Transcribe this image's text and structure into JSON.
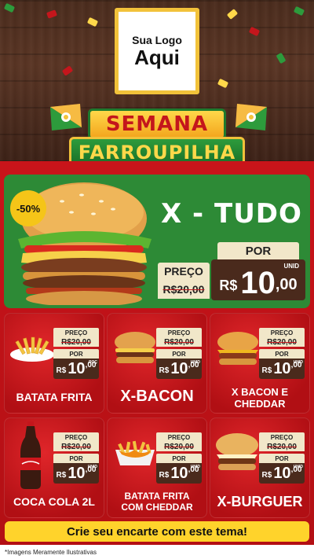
{
  "logo": {
    "line1": "Sua Logo",
    "line2": "Aqui"
  },
  "title": {
    "line1": "SEMANA",
    "line2": "FARROUPILHA"
  },
  "hero": {
    "discount": "-50%",
    "name": "X - TUDO",
    "preco_label": "PREÇO",
    "old_price": "R$20,00",
    "por_label": "POR",
    "currency": "R$",
    "price_int": "10",
    "price_dec": ",00",
    "unit": "UNID"
  },
  "products": [
    {
      "name_line1": "BATATA FRITA",
      "name_line2": "",
      "preco_label": "PREÇO",
      "old_price": "R$20,00",
      "por_label": "POR",
      "currency": "R$",
      "price_int": "10",
      "price_dec": ",00",
      "unit": "POÇ",
      "icon": "fries-icon"
    },
    {
      "name_line1": "X-BACON",
      "name_line2": "",
      "preco_label": "PREÇO",
      "old_price": "R$20,00",
      "por_label": "POR",
      "currency": "R$",
      "price_int": "10",
      "price_dec": ",00",
      "unit": "UNID",
      "icon": "burger-icon"
    },
    {
      "name_line1": "X BACON E",
      "name_line2": "CHEDDAR",
      "preco_label": "PREÇO",
      "old_price": "R$20,00",
      "por_label": "POR",
      "currency": "R$",
      "price_int": "10",
      "price_dec": ",00",
      "unit": "UNID",
      "icon": "burger-icon"
    },
    {
      "name_line1": "COCA COLA 2L",
      "name_line2": "",
      "preco_label": "PREÇO",
      "old_price": "R$20,00",
      "por_label": "POR",
      "currency": "R$",
      "price_int": "10",
      "price_dec": ",00",
      "unit": "UNID",
      "icon": "bottle-icon"
    },
    {
      "name_line1": "BATATA FRITA",
      "name_line2": "COM CHEDDAR",
      "preco_label": "PREÇO",
      "old_price": "R$20,00",
      "por_label": "POR",
      "currency": "R$",
      "price_int": "10",
      "price_dec": ",00",
      "unit": "UNID",
      "icon": "fries-cheddar-icon"
    },
    {
      "name_line1": "X-BURGUER",
      "name_line2": "",
      "preco_label": "PREÇO",
      "old_price": "R$20,00",
      "por_label": "POR",
      "currency": "R$",
      "price_int": "10",
      "price_dec": ",00",
      "unit": "UNID",
      "icon": "burger-icon"
    }
  ],
  "cta": "Crie seu encarte com este tema!",
  "disclaimer": "*Imagens Meramente Ilustrativas",
  "colors": {
    "red": "#c9141a",
    "green": "#2d8a36",
    "yellow": "#ffd32b",
    "brown": "#4a2a1c",
    "cream": "#f1e7c9"
  }
}
